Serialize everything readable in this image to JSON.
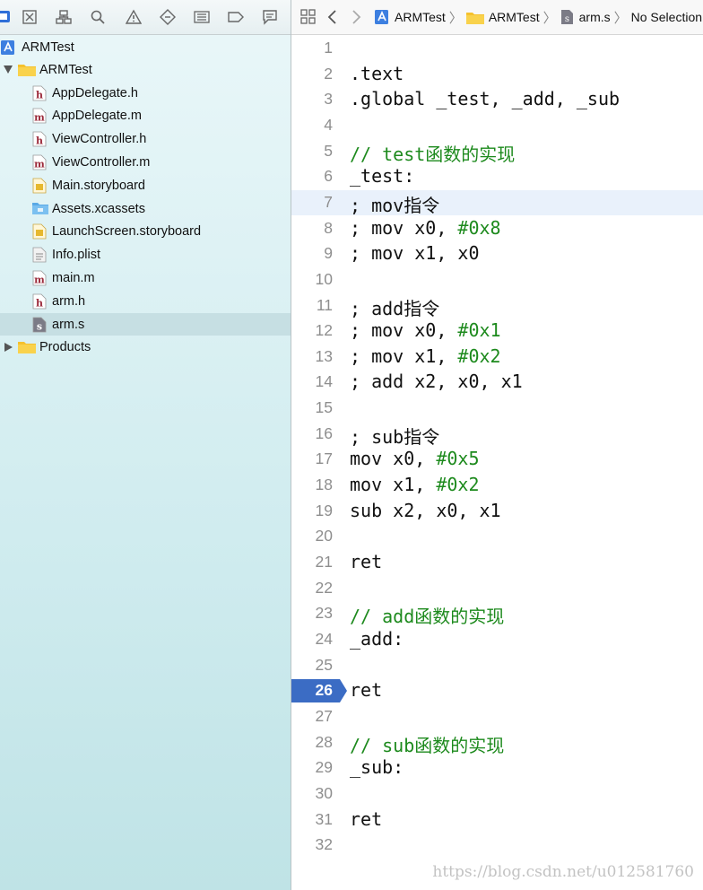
{
  "navigator": {
    "project": "ARMTest",
    "group": "ARMTest",
    "files": [
      {
        "name": "AppDelegate.h",
        "kind": "h"
      },
      {
        "name": "AppDelegate.m",
        "kind": "m"
      },
      {
        "name": "ViewController.h",
        "kind": "h"
      },
      {
        "name": "ViewController.m",
        "kind": "m"
      },
      {
        "name": "Main.storyboard",
        "kind": "storyboard"
      },
      {
        "name": "Assets.xcassets",
        "kind": "assets"
      },
      {
        "name": "LaunchScreen.storyboard",
        "kind": "storyboard"
      },
      {
        "name": "Info.plist",
        "kind": "plist"
      },
      {
        "name": "main.m",
        "kind": "m"
      },
      {
        "name": "arm.h",
        "kind": "h"
      },
      {
        "name": "arm.s",
        "kind": "s",
        "selected": true
      }
    ],
    "products": "Products",
    "icon_letters": {
      "h": "h",
      "m": "m",
      "s": "s"
    }
  },
  "jumpbar": {
    "project": "ARMTest",
    "group": "ARMTest",
    "file": "arm.s",
    "selection": "No Selection"
  },
  "editor": {
    "breakpoint_line": 26,
    "highlighted_line": 7,
    "lines": [
      {
        "n": 1,
        "text": ""
      },
      {
        "n": 2,
        "text": ".text"
      },
      {
        "n": 3,
        "text": ".global _test, _add, _sub"
      },
      {
        "n": 4,
        "text": ""
      },
      {
        "n": 5,
        "text": "// test函数的实现",
        "style": "comment"
      },
      {
        "n": 6,
        "text": "_test:"
      },
      {
        "n": 7,
        "text": "; mov指令"
      },
      {
        "n": 8,
        "text": "; mov x0, ",
        "num": "#0x8"
      },
      {
        "n": 9,
        "text": "; mov x1, x0"
      },
      {
        "n": 10,
        "text": ""
      },
      {
        "n": 11,
        "text": "; add指令"
      },
      {
        "n": 12,
        "text": "; mov x0, ",
        "num": "#0x1"
      },
      {
        "n": 13,
        "text": "; mov x1, ",
        "num": "#0x2"
      },
      {
        "n": 14,
        "text": "; add x2, x0, x1"
      },
      {
        "n": 15,
        "text": ""
      },
      {
        "n": 16,
        "text": "; sub指令"
      },
      {
        "n": 17,
        "text": "mov x0, ",
        "num": "#0x5"
      },
      {
        "n": 18,
        "text": "mov x1, ",
        "num": "#0x2"
      },
      {
        "n": 19,
        "text": "sub x2, x0, x1"
      },
      {
        "n": 20,
        "text": ""
      },
      {
        "n": 21,
        "text": "ret"
      },
      {
        "n": 22,
        "text": ""
      },
      {
        "n": 23,
        "text": "// add函数的实现",
        "style": "comment"
      },
      {
        "n": 24,
        "text": "_add:"
      },
      {
        "n": 25,
        "text": ""
      },
      {
        "n": 26,
        "text": "ret"
      },
      {
        "n": 27,
        "text": ""
      },
      {
        "n": 28,
        "text": "// sub函数的实现",
        "style": "comment"
      },
      {
        "n": 29,
        "text": "_sub:"
      },
      {
        "n": 30,
        "text": ""
      },
      {
        "n": 31,
        "text": "ret"
      },
      {
        "n": 32,
        "text": ""
      }
    ]
  },
  "watermark": "https://blog.csdn.net/u012581760",
  "colors": {
    "accent": "#3b6cc4",
    "comment": "#1d8a1d",
    "selection": "#c6dfe3",
    "breakpoint": "#3b6cc4"
  }
}
